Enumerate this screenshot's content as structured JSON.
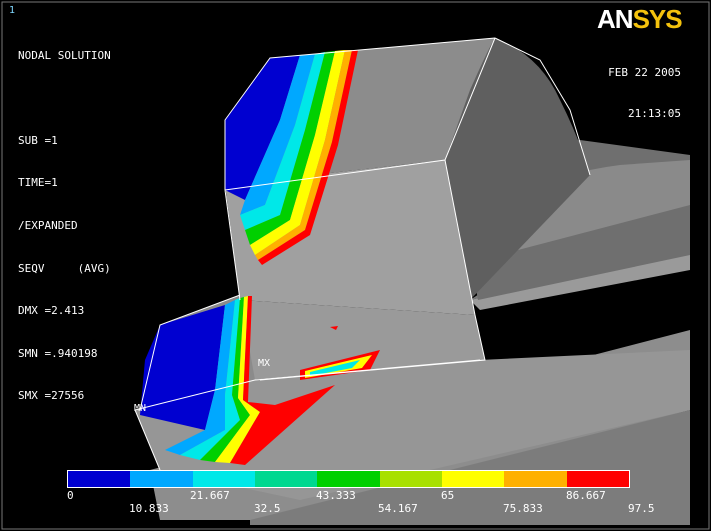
{
  "window": {
    "number": "1"
  },
  "logo": {
    "part1": "AN",
    "part2": "SYS"
  },
  "info": {
    "lines": [
      "NODAL SOLUTION",
      "",
      "SUB =1",
      "TIME=1",
      "/EXPANDED",
      "SEQV     (AVG)",
      "DMX =2.413",
      "SMN =.940198",
      "SMX =27556"
    ]
  },
  "date": {
    "day": "FEB 22 2005",
    "time": "21:13:05"
  },
  "markers": {
    "max": "MX",
    "min": "MN"
  },
  "legend": {
    "colors": [
      "#0000d0",
      "#00a8ff",
      "#00e8e8",
      "#00d890",
      "#00d000",
      "#a8e000",
      "#ffff00",
      "#ffb000",
      "#ff0000"
    ],
    "ticks_top": [
      "0",
      "21.667",
      "43.333",
      "65",
      "86.667"
    ],
    "ticks_bottom": [
      "10.833",
      "32.5",
      "54.167",
      "75.833",
      "97.5"
    ]
  }
}
